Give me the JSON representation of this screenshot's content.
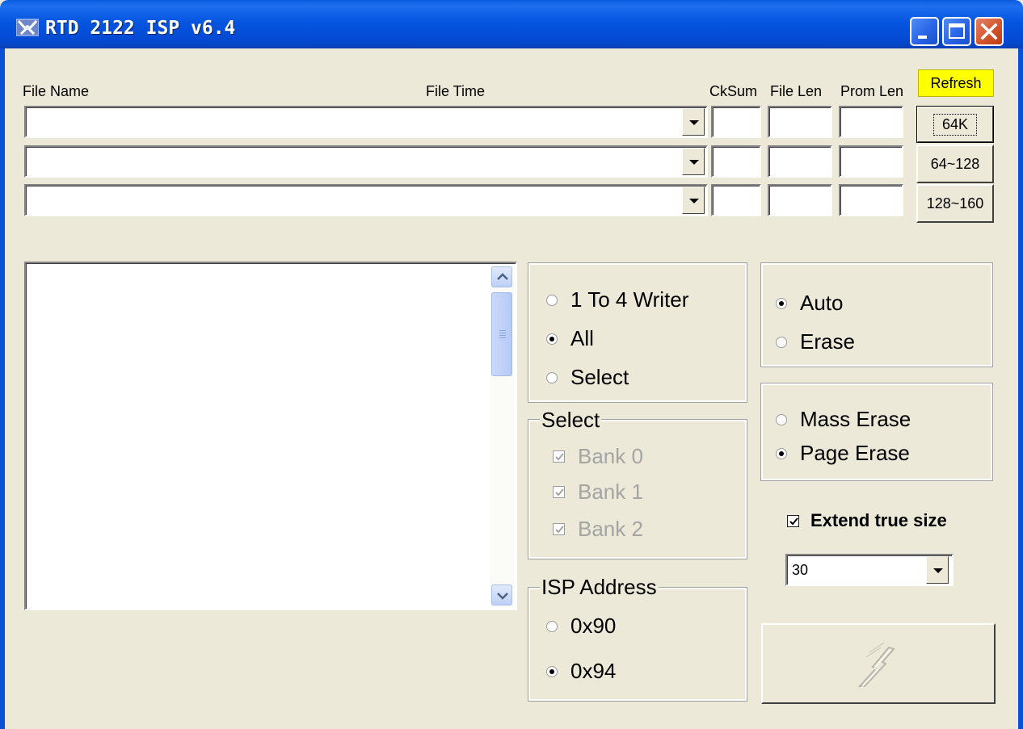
{
  "window": {
    "title": "RTD 2122 ISP v6.4",
    "icon": "app-logo-icon",
    "controls": [
      "minimize-icon",
      "maximize-icon",
      "close-icon"
    ]
  },
  "headers": {
    "file_name": "File Name",
    "file_time": "File Time",
    "cksum": "CkSum",
    "file_len": "File Len",
    "prom_len": "Prom Len"
  },
  "buttons": {
    "refresh": "Refresh",
    "bank_64k": "64K",
    "bank_64_128": "64~128",
    "bank_128_160": "128~160",
    "program_icon": "lightning-icon"
  },
  "file_rows": [
    {
      "file": "",
      "cksum": "",
      "file_len": "",
      "prom_len": ""
    },
    {
      "file": "",
      "cksum": "",
      "file_len": "",
      "prom_len": ""
    },
    {
      "file": "",
      "cksum": "",
      "file_len": "",
      "prom_len": ""
    }
  ],
  "writer_mode": {
    "options": [
      "1 To 4 Writer",
      "All",
      "Select"
    ],
    "selected": "All"
  },
  "select_group": {
    "title": "Select",
    "banks": [
      {
        "label": "Bank 0",
        "checked": true,
        "enabled": false
      },
      {
        "label": "Bank 1",
        "checked": true,
        "enabled": false
      },
      {
        "label": "Bank 2",
        "checked": true,
        "enabled": false
      }
    ]
  },
  "isp_address": {
    "title": "ISP Address",
    "options": [
      "0x90",
      "0x94"
    ],
    "selected": "0x94"
  },
  "mode": {
    "options": [
      "Auto",
      "Erase"
    ],
    "selected": "Auto"
  },
  "erase_type": {
    "options": [
      "Mass Erase",
      "Page Erase"
    ],
    "selected": "Page Erase"
  },
  "extend": {
    "label": "Extend true size",
    "checked": true
  },
  "speed_combo": {
    "value": "30"
  },
  "colors": {
    "titlebar": "#0555e0",
    "window_bg": "#ece9d8",
    "refresh_bg": "#ffff00"
  }
}
